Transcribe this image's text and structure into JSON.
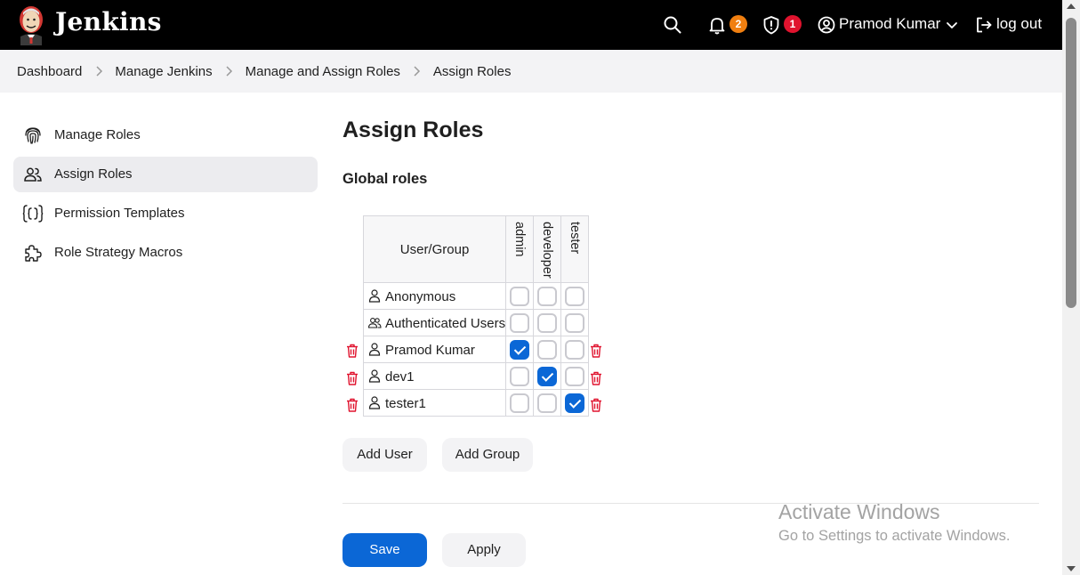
{
  "app": {
    "brand": "Jenkins"
  },
  "header": {
    "notifications_count": "2",
    "security_count": "1",
    "user_name": "Pramod Kumar",
    "logout_label": "log out",
    "colors": {
      "notif_badge": "#f07f10",
      "security_badge": "#e0132e"
    }
  },
  "breadcrumb": [
    "Dashboard",
    "Manage Jenkins",
    "Manage and Assign Roles",
    "Assign Roles"
  ],
  "sidebar": {
    "items": [
      {
        "label": "Manage Roles",
        "icon": "fingerprint-icon",
        "active": false
      },
      {
        "label": "Assign Roles",
        "icon": "users-icon",
        "active": true
      },
      {
        "label": "Permission Templates",
        "icon": "braces-icon",
        "active": false
      },
      {
        "label": "Role Strategy Macros",
        "icon": "puzzle-icon",
        "active": false
      }
    ]
  },
  "main": {
    "title": "Assign Roles",
    "section_title": "Global roles",
    "table": {
      "header": "User/Group",
      "roles": [
        "admin",
        "developer",
        "tester"
      ],
      "rows": [
        {
          "name": "Anonymous",
          "icon": "user-icon",
          "deletable": false,
          "checked": [
            false,
            false,
            false
          ]
        },
        {
          "name": "Authenticated Users",
          "icon": "group-icon",
          "deletable": false,
          "checked": [
            false,
            false,
            false
          ]
        },
        {
          "name": "Pramod Kumar",
          "icon": "user-icon",
          "deletable": true,
          "checked": [
            true,
            false,
            false
          ]
        },
        {
          "name": "dev1",
          "icon": "user-icon",
          "deletable": true,
          "checked": [
            false,
            true,
            false
          ]
        },
        {
          "name": "tester1",
          "icon": "user-icon",
          "deletable": true,
          "checked": [
            false,
            false,
            true
          ]
        }
      ]
    },
    "add_user_label": "Add User",
    "add_group_label": "Add Group",
    "save_label": "Save",
    "apply_label": "Apply"
  },
  "overlay": {
    "watermark_title": "Activate Windows",
    "watermark_subtitle": "Go to Settings to activate Windows."
  },
  "colors": {
    "primary": "#0b67d6",
    "delete": "#e0132e"
  }
}
